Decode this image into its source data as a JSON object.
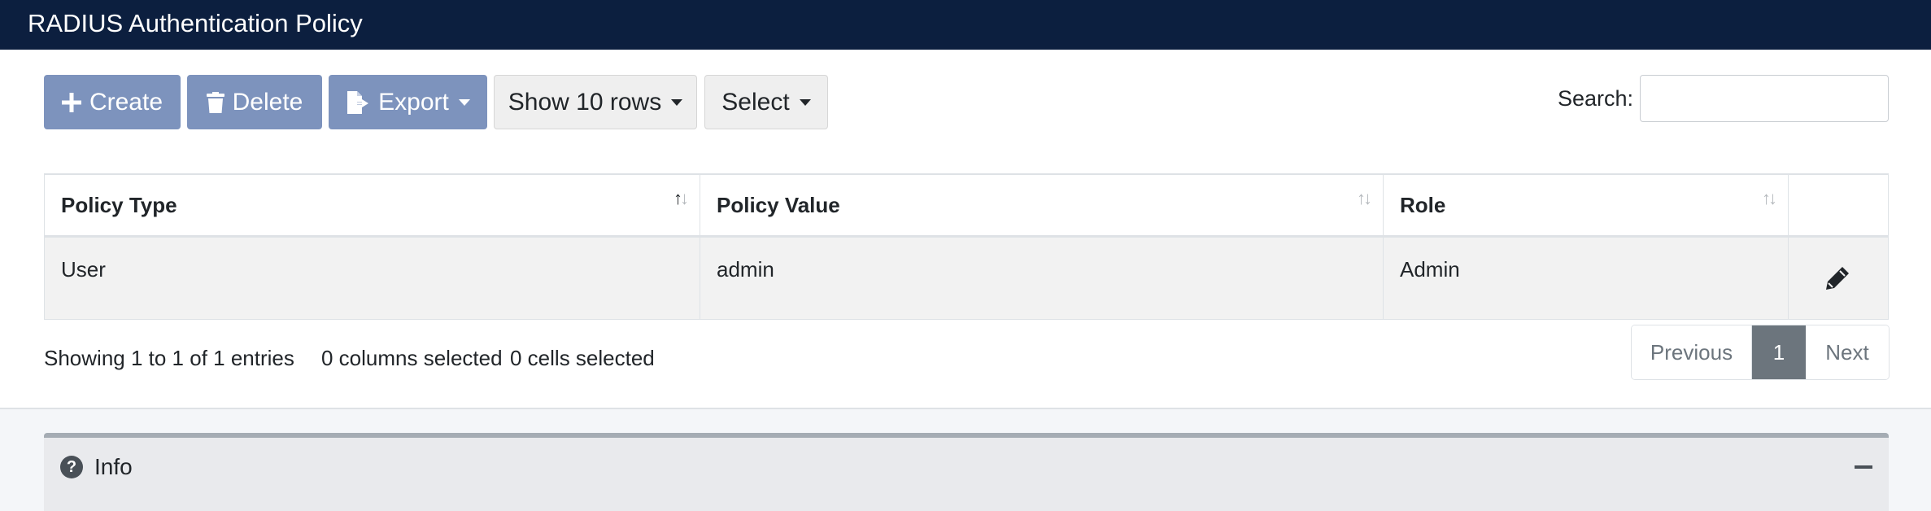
{
  "header": {
    "title": "RADIUS Authentication Policy"
  },
  "toolbar": {
    "create_label": "Create",
    "delete_label": "Delete",
    "export_label": "Export",
    "show_rows_label": "Show 10 rows",
    "select_label": "Select",
    "search_label": "Search:",
    "search_value": ""
  },
  "table": {
    "columns": [
      "Policy Type",
      "Policy Value",
      "Role"
    ],
    "rows": [
      {
        "policy_type": "User",
        "policy_value": "admin",
        "role": "Admin"
      }
    ]
  },
  "status": {
    "showing": "Showing 1 to 1 of 1 entries",
    "columns_selected": "0 columns selected",
    "cells_selected": "0 cells selected"
  },
  "pagination": {
    "previous": "Previous",
    "current": "1",
    "next": "Next"
  },
  "info_panel": {
    "title": "Info"
  },
  "icons": {
    "create": "plus-icon",
    "delete": "trash-icon",
    "export": "file-export-icon",
    "edit": "pencil-icon",
    "info": "question-circle-icon",
    "collapse": "minus-icon"
  },
  "colors": {
    "titlebar": "#0c1f3f",
    "primary_button": "#7d93bd",
    "active_page": "#6c757d"
  }
}
